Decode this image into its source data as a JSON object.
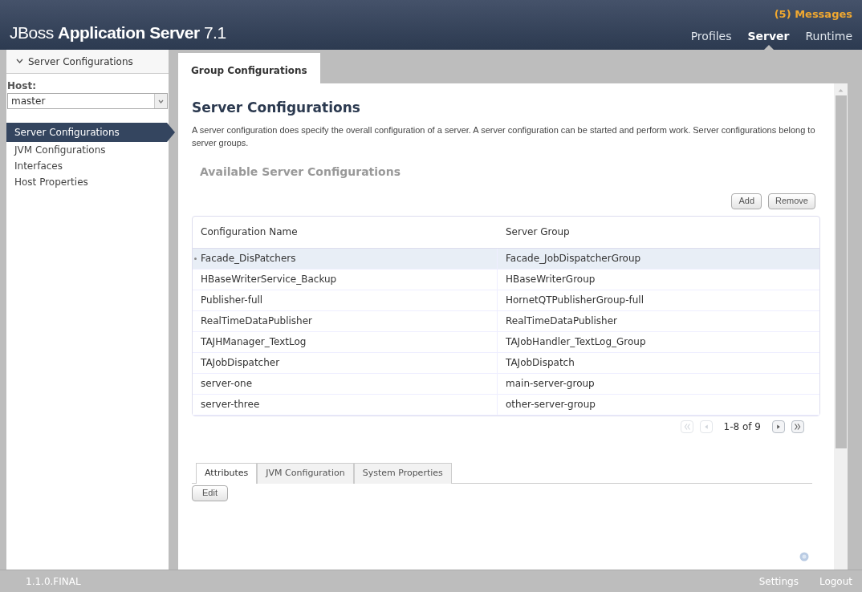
{
  "header": {
    "logo": "JBoss **Application Server** 7.1",
    "messages": "(5) Messages",
    "nav": [
      {
        "label": "Profiles",
        "selected": false
      },
      {
        "label": "Server",
        "selected": true
      },
      {
        "label": "Runtime",
        "selected": false
      }
    ]
  },
  "sidebar": {
    "section": "Server Configurations",
    "host_label": "Host:",
    "host_value": "master",
    "items": [
      {
        "label": "Server Configurations",
        "selected": true
      },
      {
        "label": "JVM Configurations",
        "selected": false
      },
      {
        "label": "Interfaces",
        "selected": false
      },
      {
        "label": "Host Properties",
        "selected": false
      }
    ]
  },
  "tabs": [
    {
      "label": "Group Configurations",
      "selected": true
    }
  ],
  "content": {
    "title": "Server Configurations",
    "description": "A server configuration does specify the overall configuration of a server. A server configuration can be started and perform work. Server configurations belong to server groups.",
    "subtitle": "Available Server Configurations",
    "buttons": [
      "Add",
      "Remove"
    ],
    "table": {
      "columns": [
        "Configuration Name",
        "Server Group"
      ],
      "rows": [
        {
          "cells": [
            "Facade_DisPatchers",
            "Facade_JobDispatcherGroup"
          ],
          "selected": true
        },
        {
          "cells": [
            "HBaseWriterService_Backup",
            "HBaseWriterGroup"
          ],
          "selected": false
        },
        {
          "cells": [
            "Publisher-full",
            "HornetQTPublisherGroup-full"
          ],
          "selected": false
        },
        {
          "cells": [
            "RealTimeDataPublisher",
            "RealTimeDataPublisher"
          ],
          "selected": false
        },
        {
          "cells": [
            "TAJHManager_TextLog",
            "TAJobHandler_TextLog_Group"
          ],
          "selected": false
        },
        {
          "cells": [
            "TAJobDispatcher",
            "TAJobDispatch"
          ],
          "selected": false
        },
        {
          "cells": [
            "server-one",
            "main-server-group"
          ],
          "selected": false
        },
        {
          "cells": [
            "server-three",
            "other-server-group"
          ],
          "selected": false
        }
      ]
    },
    "pager": {
      "text": "1-8 of 9",
      "buttons": [
        {
          "kind": "first",
          "disabled": true
        },
        {
          "kind": "prev",
          "disabled": true
        },
        {
          "kind": "next",
          "disabled": false
        },
        {
          "kind": "last",
          "disabled": false
        }
      ]
    },
    "detail_tabs": [
      {
        "label": "Attributes",
        "selected": true
      },
      {
        "label": "JVM Configuration",
        "selected": false
      },
      {
        "label": "System Properties",
        "selected": false
      }
    ],
    "edit_button": "Edit"
  },
  "footer": {
    "version": "1.1.0.FINAL",
    "links": [
      "Settings",
      "Logout"
    ]
  }
}
